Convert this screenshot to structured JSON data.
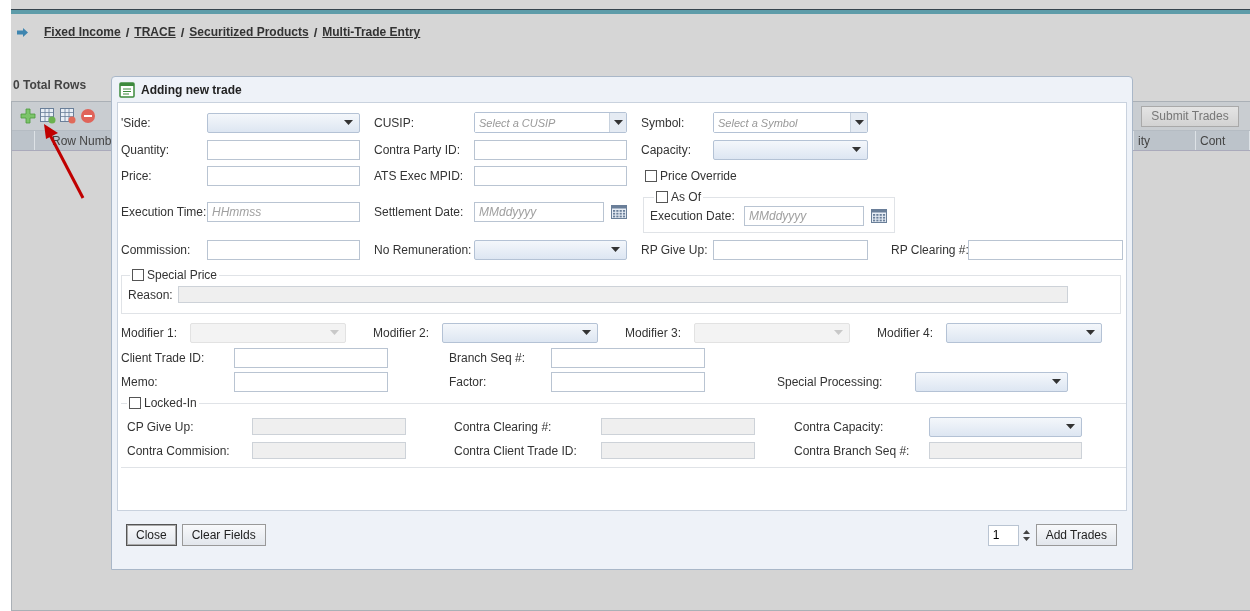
{
  "breadcrumb": [
    {
      "kind": "link",
      "label": "Fixed Income"
    },
    {
      "kind": "separator",
      "label": "/"
    },
    {
      "kind": "link",
      "label": "TRACE"
    },
    {
      "kind": "separator",
      "label": "/"
    },
    {
      "kind": "link",
      "label": "Securitized Products"
    },
    {
      "kind": "separator",
      "label": "/"
    },
    {
      "kind": "link",
      "label": "Multi-Trade Entry"
    }
  ],
  "total_rows": "0 Total Rows",
  "grid": {
    "submit_button": "Submit Trades",
    "columns": [
      "Row Numb",
      "ity",
      "Cont"
    ]
  },
  "dialog": {
    "title": "Adding new trade",
    "main_rows": [
      [
        {
          "kind": "select",
          "label": "'Side:"
        },
        {
          "kind": "combo",
          "label": "CUSIP:",
          "placeholder": "Select a CUSIP"
        },
        {
          "kind": "combo",
          "label": "Symbol:",
          "placeholder": "Select a Symbol"
        }
      ],
      [
        {
          "kind": "input",
          "label": "Quantity:"
        },
        {
          "kind": "input",
          "label": "Contra Party ID:"
        },
        {
          "kind": "select",
          "label": "Capacity:"
        }
      ],
      [
        {
          "kind": "input",
          "label": "Price:"
        },
        {
          "kind": "input",
          "label": "ATS Exec MPID:"
        },
        {
          "kind": "checkbox",
          "label": "Price Override",
          "checked": false
        }
      ],
      [
        {
          "kind": "input",
          "label": "Execution Time:",
          "placeholder": "HHmmss"
        },
        {
          "kind": "date",
          "label": "Settlement Date:",
          "placeholder": "MMddyyyy"
        },
        {
          "kind": "asof",
          "label": "As Of",
          "checked": false,
          "field": {
            "label": "Execution Date:",
            "placeholder": "MMddyyyy"
          }
        }
      ],
      [
        {
          "kind": "input",
          "label": "Commission:"
        },
        {
          "kind": "select",
          "label": "No Remuneration:"
        },
        {
          "kind": "input",
          "label": "RP Give Up:"
        },
        {
          "kind": "input",
          "label": "RP Clearing #:"
        }
      ]
    ],
    "special_price": {
      "label": "Special Price",
      "checked": false,
      "reason": {
        "label": "Reason:",
        "disabled": true
      }
    },
    "modifier_row": [
      {
        "kind": "select",
        "label": "Modifier 1:",
        "disabled": true
      },
      {
        "kind": "select",
        "label": "Modifier 2:",
        "disabled": false
      },
      {
        "kind": "select",
        "label": "Modifier 3:",
        "disabled": true
      },
      {
        "kind": "select",
        "label": "Modifier 4:",
        "disabled": false
      }
    ],
    "detail_rows": [
      [
        {
          "kind": "input",
          "label": "Client Trade ID:"
        },
        {
          "kind": "input",
          "label": "Branch Seq #:"
        }
      ],
      [
        {
          "kind": "input",
          "label": "Memo:"
        },
        {
          "kind": "input",
          "label": "Factor:"
        },
        {
          "kind": "select",
          "label": "Special Processing:"
        }
      ]
    ],
    "locked_in": {
      "label": "Locked-In",
      "checked": false,
      "rows": [
        [
          {
            "kind": "input",
            "label": "CP Give Up:",
            "disabled": true
          },
          {
            "kind": "input",
            "label": "Contra Clearing #:",
            "disabled": true
          },
          {
            "kind": "select",
            "label": "Contra Capacity:",
            "disabled": false
          }
        ],
        [
          {
            "kind": "input",
            "label": "Contra Commision:",
            "disabled": true
          },
          {
            "kind": "input",
            "label": "Contra Client Trade ID:",
            "disabled": true
          },
          {
            "kind": "input",
            "label": "Contra Branch Seq #:",
            "disabled": true
          }
        ]
      ]
    },
    "buttons": [
      {
        "label": "Close",
        "focused": true
      },
      {
        "label": "Clear Fields",
        "focused": false
      }
    ],
    "trade_count": "1",
    "add_button": "Add Trades"
  }
}
